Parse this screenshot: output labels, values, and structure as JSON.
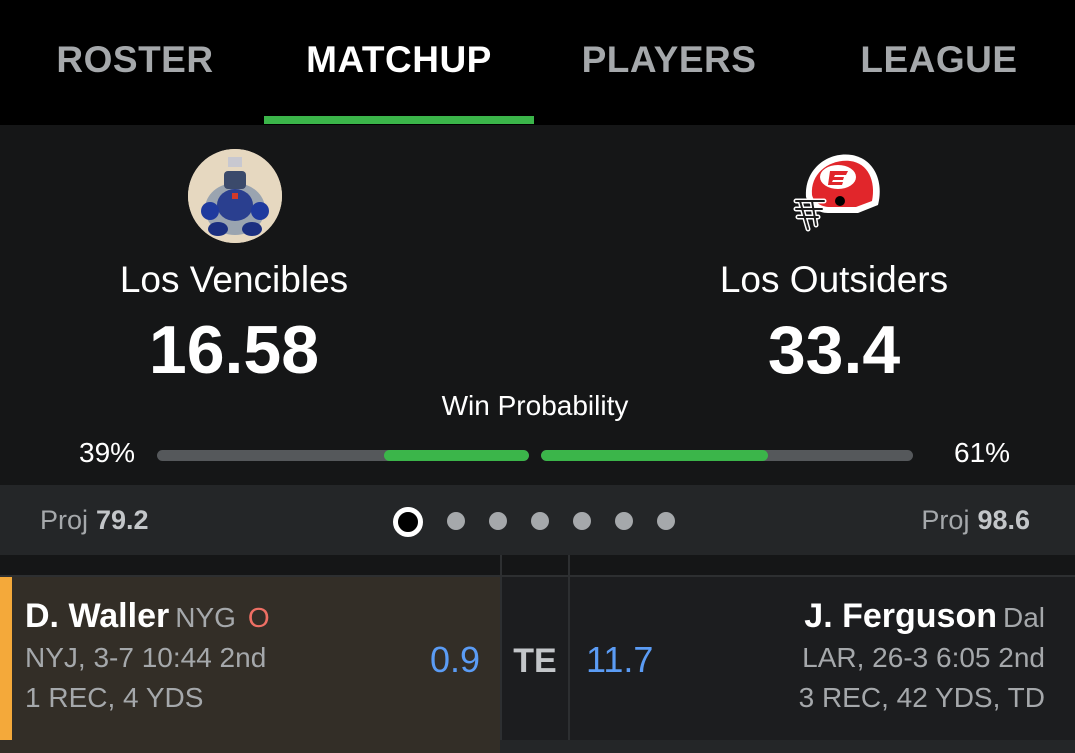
{
  "tabs": [
    {
      "label": "ROSTER"
    },
    {
      "label": "MATCHUP"
    },
    {
      "label": "PLAYERS"
    },
    {
      "label": "LEAGUE"
    }
  ],
  "active_tab": "MATCHUP",
  "accent_color": "#3bb54a",
  "matchup": {
    "home": {
      "name": "Los Vencibles",
      "score": "16.58",
      "win_pct": "39%",
      "win_prob": 0.39,
      "proj_label": "Proj",
      "proj": "79.2",
      "avatar_icon": "robot-figure-avatar"
    },
    "away": {
      "name": "Los Outsiders",
      "score": "33.4",
      "win_pct": "61%",
      "win_prob": 0.61,
      "proj_label": "Proj",
      "proj": "98.6",
      "avatar_icon": "espn-helmet-logo"
    },
    "win_prob_label": "Win Probability"
  },
  "pager": {
    "total": 7,
    "active": 1
  },
  "players": [
    {
      "position": "TE",
      "left": {
        "name": "D. Waller",
        "team": "NYG",
        "status": "O",
        "line1": "NYJ, 3-7 10:44 2nd",
        "line2": "1 REC, 4 YDS",
        "points": "0.9"
      },
      "right": {
        "name": "J. Ferguson",
        "team": "Dal",
        "line1": "LAR, 26-3 6:05 2nd",
        "line2": "3 REC, 42 YDS, TD",
        "points": "11.7"
      }
    }
  ]
}
